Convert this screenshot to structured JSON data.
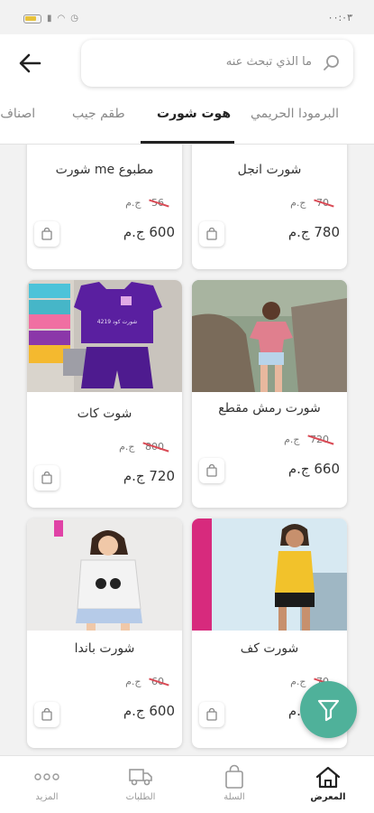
{
  "status_bar": {
    "time": "٠٠:٠٣"
  },
  "header": {
    "search_placeholder": "ما الذي تبحث عنه"
  },
  "tabs": [
    {
      "label": "البرمودا الحريمي",
      "active": false
    },
    {
      "label": "هوت شورت",
      "active": true
    },
    {
      "label": "طقم جيب",
      "active": false
    },
    {
      "label": "اصناف ا",
      "active": false
    }
  ],
  "products": [
    {
      "title": "مطبوع me شورت",
      "old_price": "56",
      "currency": "ج.م",
      "price": "600 ج.م"
    },
    {
      "title": "شورت انجل",
      "old_price": "70",
      "currency": "ج.م",
      "price": "780 ج.م"
    },
    {
      "title": "شوت كات",
      "old_price": "800",
      "currency": "ج.م",
      "price": "720 ج.م"
    },
    {
      "title": "شورت رمش مقطع",
      "old_price": "720",
      "currency": "ج.م",
      "price": "660 ج.م"
    },
    {
      "title": "شورت باندا",
      "old_price": "60",
      "currency": "ج.م",
      "price": "600 ج.م"
    },
    {
      "title": "شورت كف",
      "old_price": "70",
      "currency": "ج.م",
      "price": "600 ج.م"
    }
  ],
  "image_text": {
    "shirt_print": "شورت كود 4219"
  },
  "bottom_nav": [
    {
      "label": "المزيد",
      "icon": "more-icon",
      "active": false
    },
    {
      "label": "الطلبات",
      "icon": "truck-icon",
      "active": false
    },
    {
      "label": "السلة",
      "icon": "bag-icon",
      "active": false
    },
    {
      "label": "المعرض",
      "icon": "home-icon",
      "active": true
    }
  ],
  "colors": {
    "accent": "#4fb19a",
    "strike": "#d94a55"
  }
}
